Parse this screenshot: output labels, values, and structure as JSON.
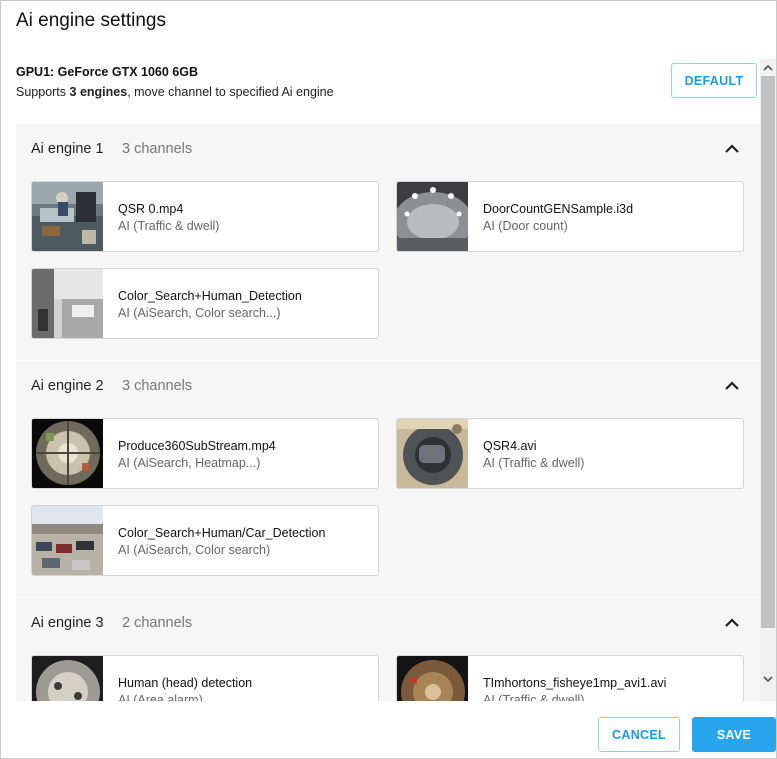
{
  "dialog": {
    "title": "Ai engine settings",
    "gpu_name": "GPU1: GeForce GTX 1060 6GB",
    "support_prefix": "Supports ",
    "support_bold": "3 engines",
    "support_suffix": ", move channel to specified Ai engine",
    "default_label": "DEFAULT",
    "cancel_label": "CANCEL",
    "save_label": "SAVE"
  },
  "engines": [
    {
      "name": "Ai engine 1",
      "count": "3 channels",
      "channels": [
        {
          "title": "QSR 0.mp4",
          "sub": "AI (Traffic & dwell)",
          "thumb": "store-counter"
        },
        {
          "title": "DoorCountGENSample.i3d",
          "sub": "AI (Door count)",
          "thumb": "overhead-door"
        },
        {
          "title": "Color_Search+Human_Detection",
          "sub": "AI (AiSearch, Color search...)",
          "thumb": "office-room"
        }
      ]
    },
    {
      "name": "Ai engine 2",
      "count": "3 channels",
      "channels": [
        {
          "title": "Produce360SubStream.mp4",
          "sub": "AI (AiSearch, Heatmap...)",
          "thumb": "fisheye-store"
        },
        {
          "title": "QSR4.avi",
          "sub": "AI (Traffic & dwell)",
          "thumb": "fisheye-outdoor"
        },
        {
          "title": "Color_Search+Human/Car_Detection",
          "sub": "AI (AiSearch, Color search)",
          "thumb": "parking-lot"
        }
      ]
    },
    {
      "name": "Ai engine 3",
      "count": "2 channels",
      "channels": [
        {
          "title": "Human (head) detection",
          "sub": "AI (Area alarm)",
          "thumb": "fisheye-indoor"
        },
        {
          "title": "TImhortons_fisheye1mp_avi1.avi",
          "sub": "AI (Traffic & dwell)",
          "thumb": "fisheye-cafe"
        }
      ]
    }
  ],
  "icons": {
    "collapse": "chevron-up-icon",
    "scroll_up": "scroll-up-arrow-icon",
    "scroll_down": "scroll-down-arrow-icon"
  },
  "colors": {
    "accent": "#27a6ee",
    "accent_outline": "#8fd3f7",
    "section_bg": "#f6f6f6",
    "card_border": "#d5d5d5"
  }
}
